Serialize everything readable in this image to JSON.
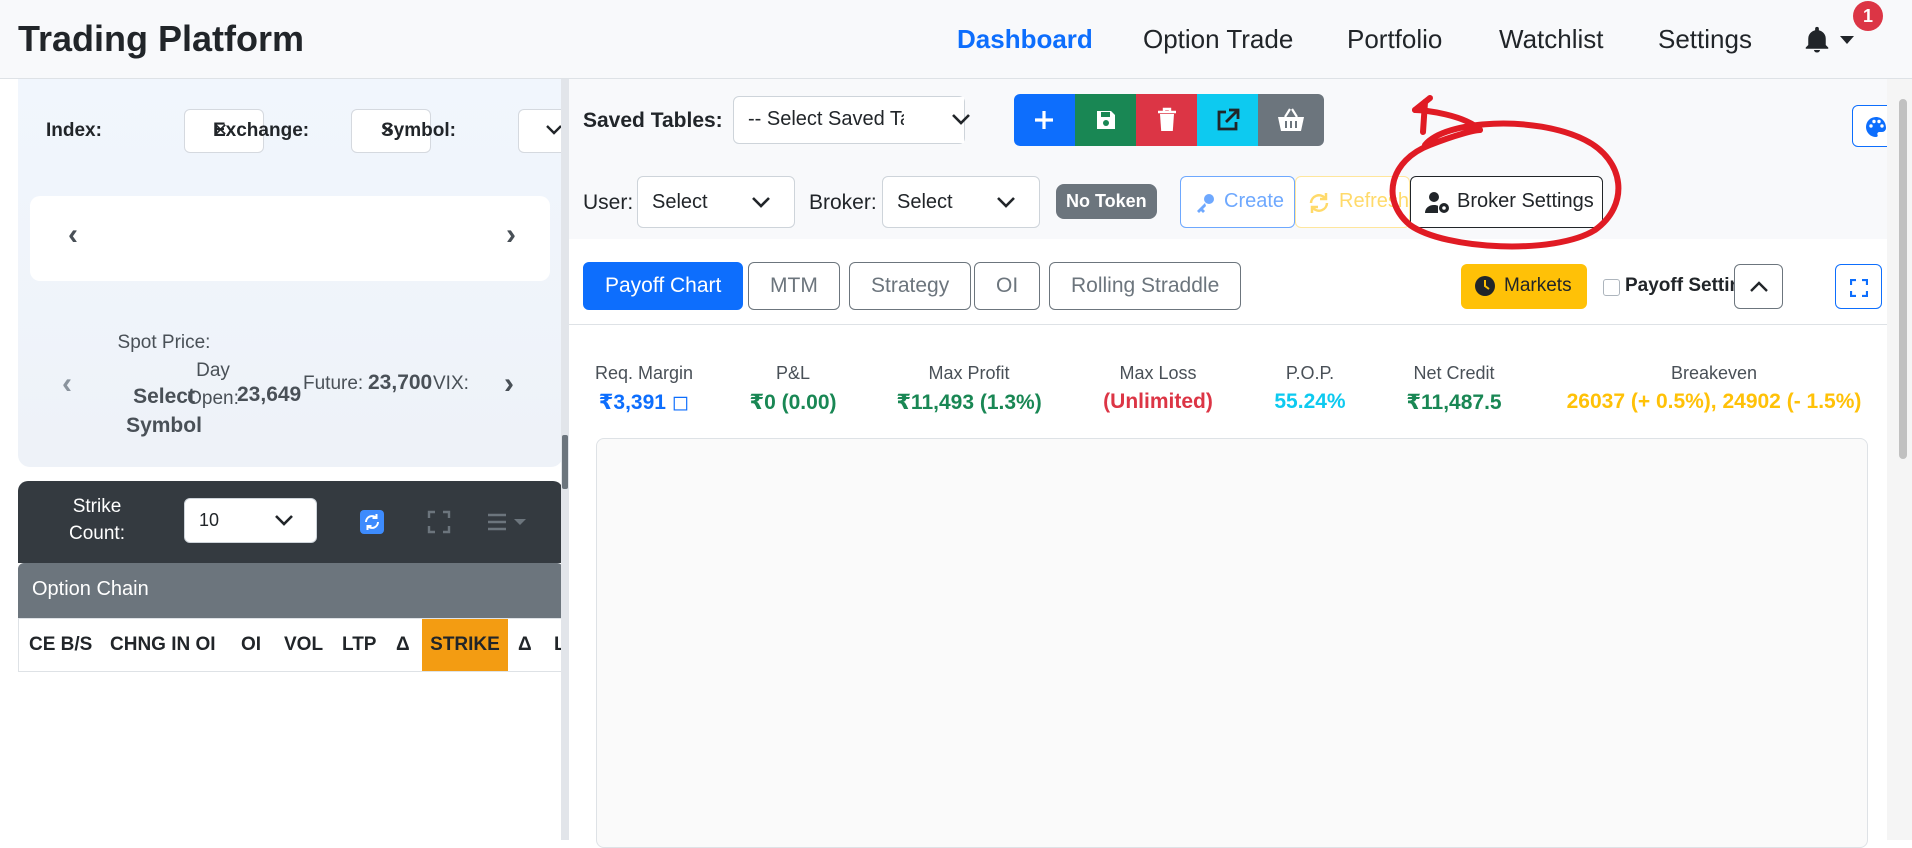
{
  "navbar": {
    "brand": "Trading Platform",
    "links": [
      "Dashboard",
      "Option Trade",
      "Portfolio",
      "Watchlist",
      "Settings"
    ],
    "active_link": "Dashboard",
    "notification_count": "1"
  },
  "left_panel": {
    "index_label": "Index:",
    "exchange_label": "Exchange:",
    "symbol_label": "Symbol:",
    "spot_price_label": "Spot Price:",
    "spot_price_value": "Select Symbol",
    "day_open_label": "Day Open:",
    "day_open_value": "23,649",
    "future_label": "Future:",
    "future_value": "23,700",
    "vix_label": "VIX:",
    "strike_count_label": "Strike Count:",
    "strike_count_value": "10",
    "option_chain_title": "Option Chain",
    "option_chain_columns": [
      "CE B/S",
      "CHNG IN OI",
      "OI",
      "VOL",
      "LTP",
      "Δ",
      "STRIKE",
      "Δ",
      "L"
    ]
  },
  "toolbar": {
    "saved_tables_label": "Saved Tables:",
    "saved_table_select": "-- Select Saved Table --",
    "user_label": "User:",
    "user_select": "Select",
    "broker_label": "Broker:",
    "broker_select": "Select",
    "token_badge": "No Token",
    "create_label": "Create",
    "refresh_label": "Refresh",
    "broker_settings_label": "Broker Settings"
  },
  "tabs": [
    "Payoff Chart",
    "MTM",
    "Strategy",
    "OI",
    "Rolling Straddle"
  ],
  "active_tab": "Payoff Chart",
  "markets_label": "Markets",
  "payoff_settings_label": "Payoff Settings",
  "metrics": [
    {
      "title": "Req. Margin",
      "value": "₹3,391 ◻",
      "color": "#0d6efd"
    },
    {
      "title": "P&L",
      "value": "₹0 (0.00)",
      "color": "#198754"
    },
    {
      "title": "Max Profit",
      "value": "₹11,493 (1.3%)",
      "color": "#198754"
    },
    {
      "title": "Max Loss",
      "value": "(Unlimited)",
      "color": "#dc3545"
    },
    {
      "title": "P.O.P.",
      "value": "55.24%",
      "color": "#0dcaf0"
    },
    {
      "title": "Net Credit",
      "value": "₹11,487.5",
      "color": "#198754"
    },
    {
      "title": "Breakeven",
      "value": "26037 (+ 0.5%), 24902 (- 1.5%)",
      "color": "#ffc107"
    }
  ],
  "colors": {
    "primary": "#0d6efd",
    "success": "#198754",
    "danger": "#dc3545",
    "info": "#0dcaf0",
    "secondary": "#6c757d",
    "warning": "#ffc107",
    "strike_header": "#f39c12",
    "annotation": "#e01b24"
  },
  "icons": {
    "add": "plus-icon",
    "save": "floppy-disk-icon",
    "delete": "trash-icon",
    "export": "external-link-icon",
    "basket": "basket-icon",
    "palette": "palette-icon",
    "key": "key-icon",
    "refresh": "sync-icon",
    "broker_settings": "user-gear-icon",
    "markets": "clock-icon",
    "collapse": "chevron-up-icon",
    "fullscreen": "expand-icon",
    "notifications": "bell-icon"
  }
}
